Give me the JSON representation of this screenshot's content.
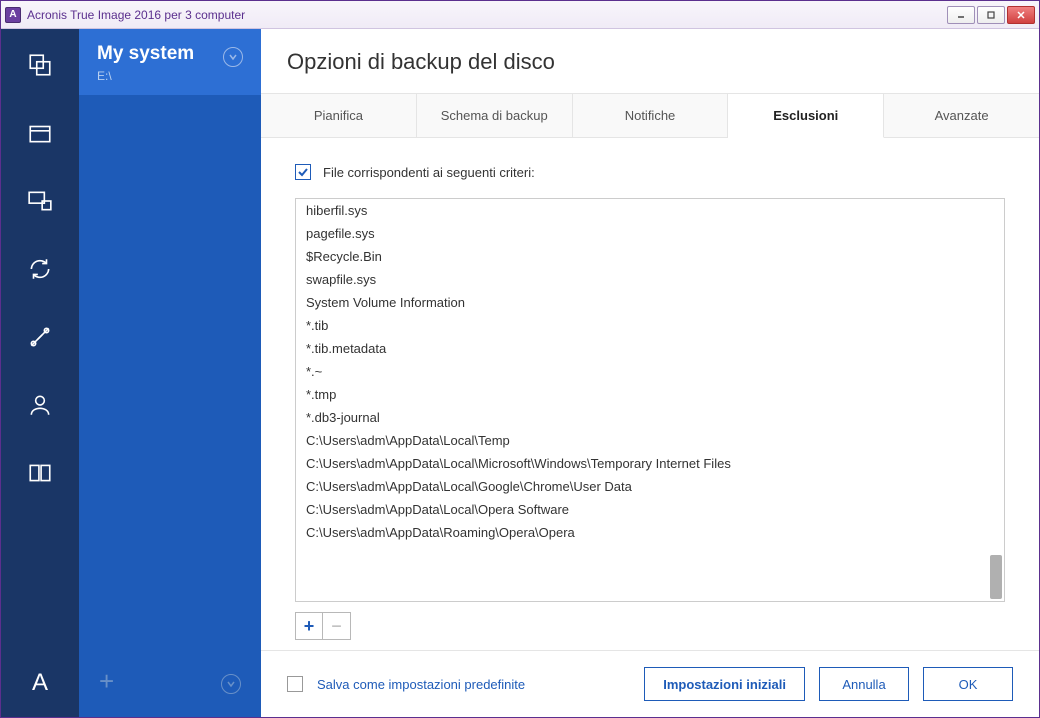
{
  "window": {
    "title": "Acronis True Image 2016 per 3 computer",
    "app_initial": "A"
  },
  "sidebar": {
    "selected": {
      "name": "My system",
      "path": "E:\\"
    }
  },
  "header": {
    "title": "Opzioni di backup del disco"
  },
  "tabs": [
    {
      "label": "Pianifica",
      "active": false
    },
    {
      "label": "Schema di backup",
      "active": false
    },
    {
      "label": "Notifiche",
      "active": false
    },
    {
      "label": "Esclusioni",
      "active": true
    },
    {
      "label": "Avanzate",
      "active": false
    }
  ],
  "criteria": {
    "checked": true,
    "label": "File corrispondenti ai seguenti criteri:"
  },
  "exclusion_items": [
    "hiberfil.sys",
    "pagefile.sys",
    "$Recycle.Bin",
    "swapfile.sys",
    "System Volume Information",
    "*.tib",
    "*.tib.metadata",
    "*.~",
    "*.tmp",
    "*.db3-journal",
    "C:\\Users\\adm\\AppData\\Local\\Temp",
    "C:\\Users\\adm\\AppData\\Local\\Microsoft\\Windows\\Temporary Internet Files",
    "C:\\Users\\adm\\AppData\\Local\\Google\\Chrome\\User Data",
    "C:\\Users\\adm\\AppData\\Local\\Opera Software",
    "C:\\Users\\adm\\AppData\\Roaming\\Opera\\Opera"
  ],
  "footer": {
    "save_default_checked": false,
    "save_default_label": "Salva come impostazioni predefinite",
    "reset_label": "Impostazioni iniziali",
    "cancel_label": "Annulla",
    "ok_label": "OK"
  },
  "icons": {
    "add": "+",
    "remove": "−",
    "plus_sidebar": "+"
  }
}
